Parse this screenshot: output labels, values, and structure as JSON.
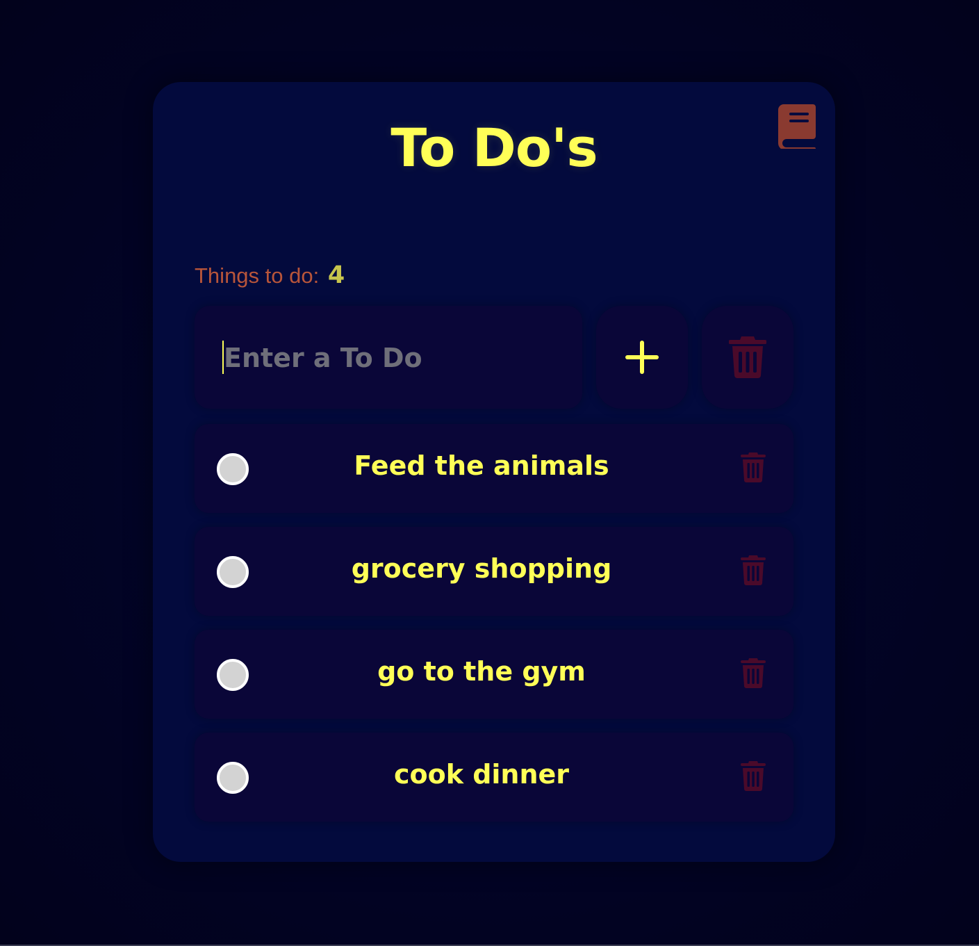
{
  "app": {
    "title": "To Do's",
    "book_icon": "book-icon"
  },
  "counter": {
    "label": "Things to do:",
    "count": "4"
  },
  "new_todo": {
    "placeholder": "Enter a To Do",
    "value": "",
    "add_icon": "plus-icon",
    "clear_icon": "trash-icon"
  },
  "todos": [
    {
      "text": "Feed the animals",
      "done": false
    },
    {
      "text": "grocery shopping",
      "done": false
    },
    {
      "text": "go to the gym",
      "done": false
    },
    {
      "text": "cook dinner",
      "done": false
    }
  ],
  "colors": {
    "background": "#020423",
    "card": "#030a3d",
    "panel": "#0a0638",
    "accent_yellow": "#ffff57",
    "counter_label": "#b8553a",
    "counter_value": "#c7c54d",
    "trash": "#4a0a2a",
    "book": "#8a3a30",
    "radio": "#d3d3d3"
  }
}
